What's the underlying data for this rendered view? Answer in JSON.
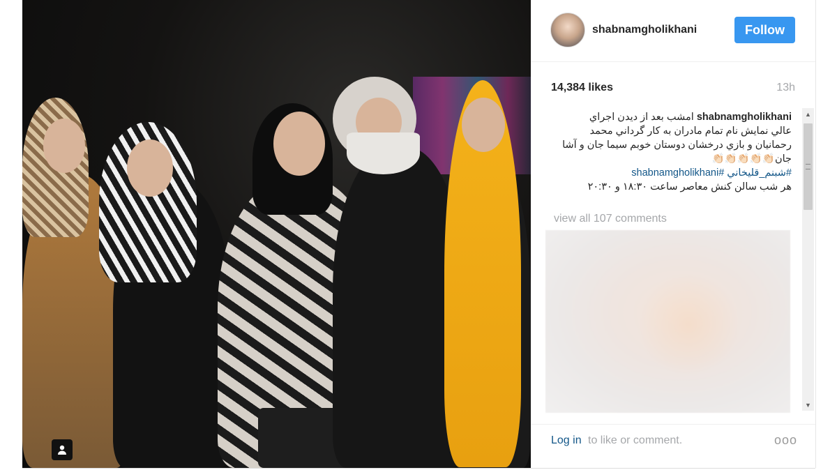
{
  "post": {
    "username": "shabnamgholikhani",
    "follow_label": "Follow",
    "likes": "14,384 likes",
    "time_ago": "13h",
    "caption_lines": [
      "امشب بعد از ديدن اجراي",
      "عالي نمايش نام تمام مادران به كار گرداني محمد",
      "رحمانيان و بازي درخشان دوستان خوبم سيما جان و آشا",
      "جان👏🏻👏🏻👏🏻👏🏻👏🏻"
    ],
    "hashtag": "#شبنم_قليخاني #shabnamgholikhani",
    "caption_last": "هر شب سالن كنش معاصر ساعت ١٨:٣٠ و ٢٠:٣٠",
    "view_all": "view all 107 comments",
    "login_label": "Log in",
    "login_suffix": "to like or comment.",
    "more": "ooo"
  },
  "icons": {
    "user_tag": "user-tag-icon",
    "more": "more-options-icon",
    "scroll_up": "scroll-up-arrow-icon",
    "scroll_down": "scroll-down-arrow-icon"
  },
  "colors": {
    "follow_button": "#3897f0",
    "link": "#125688",
    "muted": "#a5a7aa"
  }
}
